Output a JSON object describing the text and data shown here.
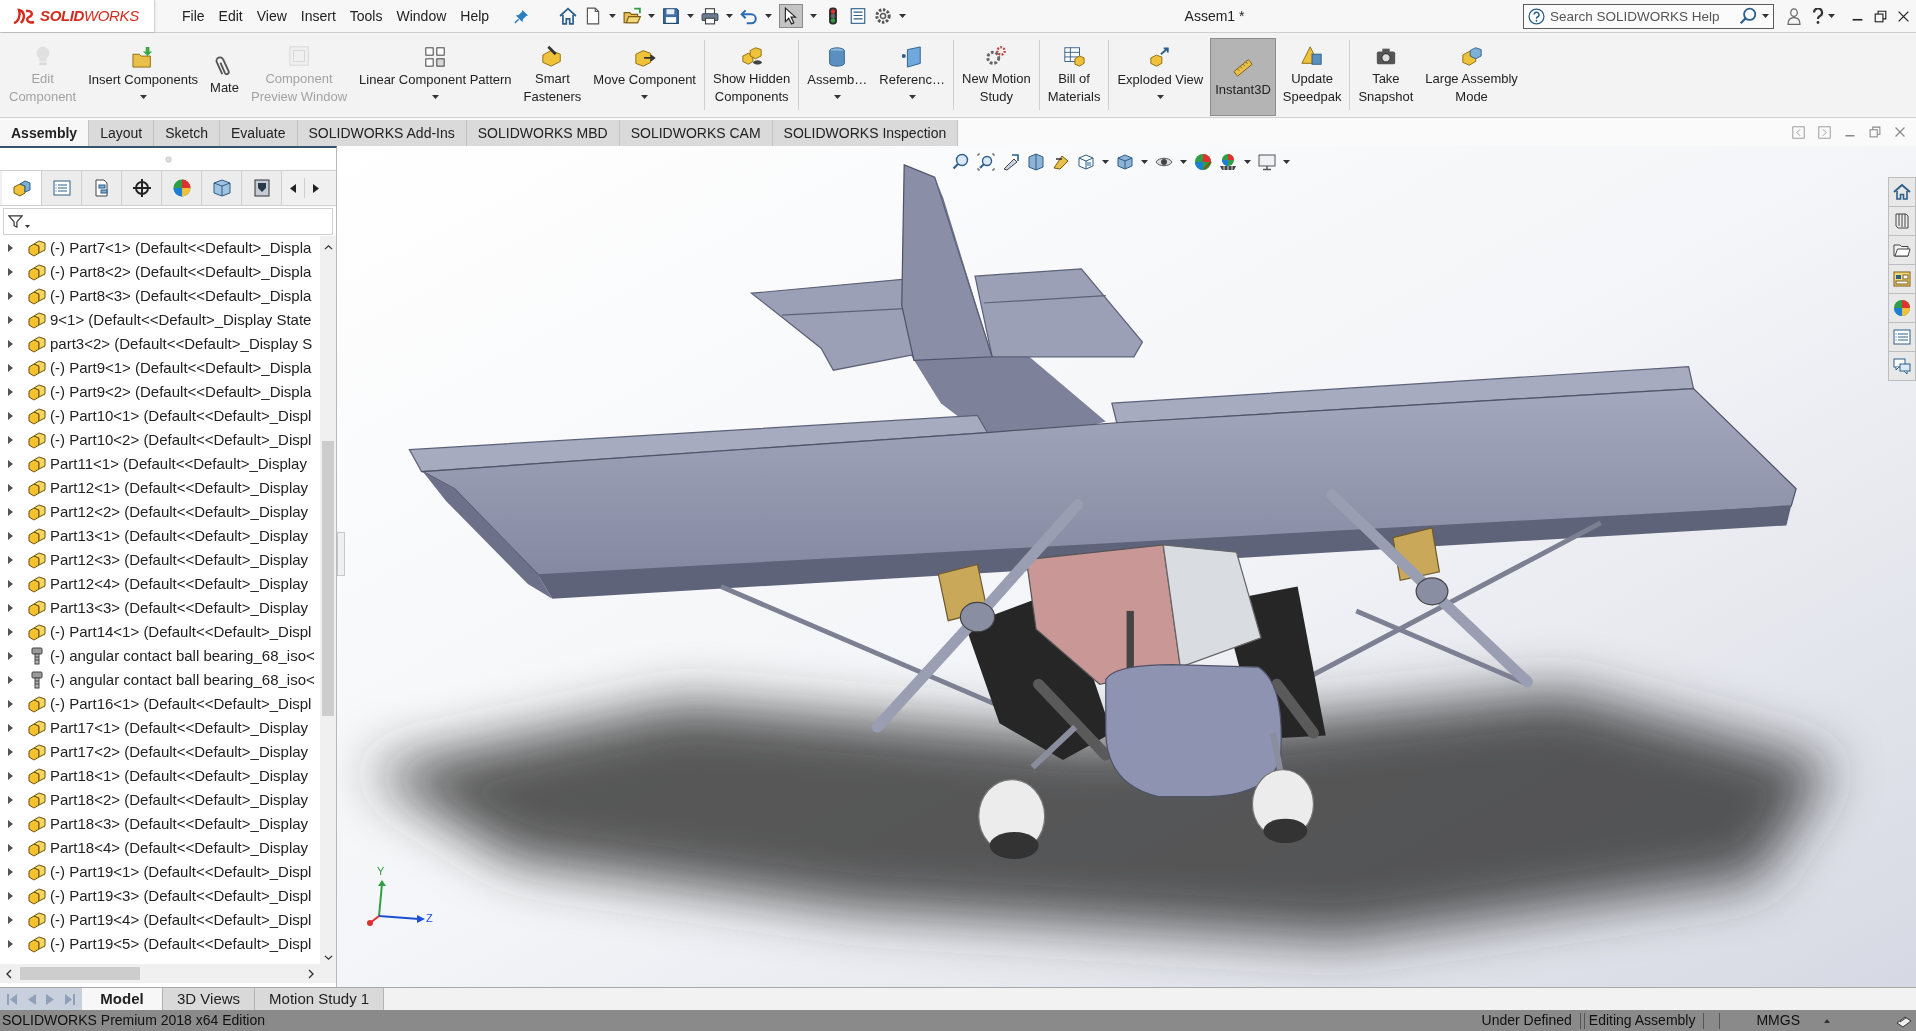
{
  "app": {
    "logo": "**SOLID**WORKS"
  },
  "menu": [
    "File",
    "Edit",
    "View",
    "Insert",
    "Tools",
    "Window",
    "Help"
  ],
  "quick_access": {
    "select_active": true
  },
  "title": "Assem1 *",
  "search": {
    "placeholder": "Search SOLIDWORKS Help"
  },
  "ribbon": {
    "groups": [
      {
        "commands": [
          {
            "label": "Edit\nComponent",
            "disabled": true,
            "dropdown": false,
            "selected": false
          },
          {
            "label": "Insert Components",
            "disabled": false,
            "dropdown": true,
            "selected": false
          },
          {
            "label": "Mate",
            "disabled": false,
            "dropdown": false,
            "selected": false
          },
          {
            "label": "Component\nPreview Window",
            "disabled": true,
            "dropdown": false,
            "selected": false
          },
          {
            "label": "Linear Component Pattern",
            "disabled": false,
            "dropdown": true,
            "selected": false
          },
          {
            "label": "Smart\nFasteners",
            "disabled": false,
            "dropdown": false,
            "selected": false
          },
          {
            "label": "Move Component",
            "disabled": false,
            "dropdown": true,
            "selected": false
          }
        ]
      },
      {
        "commands": [
          {
            "label": "Show Hidden\nComponents",
            "disabled": false,
            "dropdown": false,
            "selected": false
          }
        ]
      },
      {
        "commands": [
          {
            "label": "Assemb…",
            "disabled": false,
            "dropdown": true,
            "selected": false
          },
          {
            "label": "Referenc…",
            "disabled": false,
            "dropdown": true,
            "selected": false
          }
        ]
      },
      {
        "commands": [
          {
            "label": "New Motion\nStudy",
            "disabled": false,
            "dropdown": false,
            "selected": false
          }
        ]
      },
      {
        "commands": [
          {
            "label": "Bill of\nMaterials",
            "disabled": false,
            "dropdown": false,
            "selected": false
          }
        ]
      },
      {
        "commands": [
          {
            "label": "Exploded View",
            "disabled": false,
            "dropdown": true,
            "selected": false
          },
          {
            "label": "Instant3D",
            "disabled": false,
            "dropdown": false,
            "selected": true
          },
          {
            "label": "Update\nSpeedpak",
            "disabled": false,
            "dropdown": false,
            "selected": false
          }
        ]
      },
      {
        "commands": [
          {
            "label": "Take\nSnapshot",
            "disabled": false,
            "dropdown": false,
            "selected": false
          },
          {
            "label": "Large Assembly\nMode",
            "disabled": false,
            "dropdown": false,
            "selected": false
          }
        ]
      }
    ]
  },
  "tabs": [
    {
      "label": "Assembly",
      "selected": true
    },
    {
      "label": "Layout",
      "selected": false
    },
    {
      "label": "Sketch",
      "selected": false
    },
    {
      "label": "Evaluate",
      "selected": false
    },
    {
      "label": "SOLIDWORKS Add-Ins",
      "selected": false
    },
    {
      "label": "SOLIDWORKS MBD",
      "selected": false
    },
    {
      "label": "SOLIDWORKS CAM",
      "selected": false
    },
    {
      "label": "SOLIDWORKS Inspection",
      "selected": false
    }
  ],
  "feature_manager": {
    "panel_tabs": [
      {
        "selected": true
      },
      {
        "selected": false
      },
      {
        "selected": false
      },
      {
        "selected": false
      },
      {
        "selected": false
      },
      {
        "selected": false
      },
      {
        "selected": false
      }
    ],
    "tree": [
      {
        "kind": "part",
        "label": "(-) Part7<1> (Default<<Default>_Displa",
        "expanded": false
      },
      {
        "kind": "part",
        "label": "(-) Part8<2> (Default<<Default>_Displa",
        "expanded": false
      },
      {
        "kind": "part",
        "label": "(-) Part8<3> (Default<<Default>_Displa",
        "expanded": false
      },
      {
        "kind": "part",
        "label": "9<1> (Default<<Default>_Display State",
        "expanded": false
      },
      {
        "kind": "part",
        "label": "part3<2> (Default<<Default>_Display S",
        "expanded": false
      },
      {
        "kind": "part",
        "label": "(-) Part9<1> (Default<<Default>_Displa",
        "expanded": false
      },
      {
        "kind": "part",
        "label": "(-) Part9<2> (Default<<Default>_Displa",
        "expanded": false
      },
      {
        "kind": "part",
        "label": "(-) Part10<1> (Default<<Default>_Displ",
        "expanded": false
      },
      {
        "kind": "part",
        "label": "(-) Part10<2> (Default<<Default>_Displ",
        "expanded": false
      },
      {
        "kind": "part",
        "label": "Part11<1> (Default<<Default>_Display",
        "expanded": false
      },
      {
        "kind": "part",
        "label": "Part12<1> (Default<<Default>_Display",
        "expanded": false
      },
      {
        "kind": "part",
        "label": "Part12<2> (Default<<Default>_Display",
        "expanded": false
      },
      {
        "kind": "part",
        "label": "Part13<1> (Default<<Default>_Display",
        "expanded": false
      },
      {
        "kind": "part",
        "label": "Part12<3> (Default<<Default>_Display",
        "expanded": false
      },
      {
        "kind": "part",
        "label": "Part12<4> (Default<<Default>_Display",
        "expanded": false
      },
      {
        "kind": "part",
        "label": "Part13<3> (Default<<Default>_Display",
        "expanded": false
      },
      {
        "kind": "part",
        "label": "(-) Part14<1> (Default<<Default>_Displ",
        "expanded": false
      },
      {
        "kind": "toolbox",
        "label": "(-) angular contact ball bearing_68_iso<",
        "expanded": false
      },
      {
        "kind": "toolbox",
        "label": "(-) angular contact ball bearing_68_iso<",
        "expanded": false
      },
      {
        "kind": "part",
        "label": "(-) Part16<1> (Default<<Default>_Displ",
        "expanded": false
      },
      {
        "kind": "part",
        "label": "Part17<1> (Default<<Default>_Display",
        "expanded": false
      },
      {
        "kind": "part",
        "label": "Part17<2> (Default<<Default>_Display",
        "expanded": false
      },
      {
        "kind": "part",
        "label": "Part18<1> (Default<<Default>_Display",
        "expanded": false
      },
      {
        "kind": "part",
        "label": "Part18<2> (Default<<Default>_Display",
        "expanded": false
      },
      {
        "kind": "part",
        "label": "Part18<3> (Default<<Default>_Display",
        "expanded": false
      },
      {
        "kind": "part",
        "label": "Part18<4> (Default<<Default>_Display",
        "expanded": false
      },
      {
        "kind": "part",
        "label": "(-) Part19<1> (Default<<Default>_Displ",
        "expanded": false
      },
      {
        "kind": "part",
        "label": "(-) Part19<3> (Default<<Default>_Displ",
        "expanded": false
      },
      {
        "kind": "part",
        "label": "(-) Part19<4> (Default<<Default>_Displ",
        "expanded": false
      },
      {
        "kind": "part",
        "label": "(-) Part19<5> (Default<<Default>_Displ",
        "expanded": false
      }
    ]
  },
  "viewport": {
    "triad": {
      "y_label": "Y",
      "z_label": "Z"
    }
  },
  "bottom_tabs": [
    {
      "label": "Model",
      "selected": true
    },
    {
      "label": "3D Views",
      "selected": false
    },
    {
      "label": "Motion Study 1",
      "selected": false
    }
  ],
  "status_bar": {
    "edition": "SOLIDWORKS Premium 2018 x64 Edition",
    "definition": "Under Defined",
    "mode": "Editing Assembly",
    "units": "MMGS"
  }
}
